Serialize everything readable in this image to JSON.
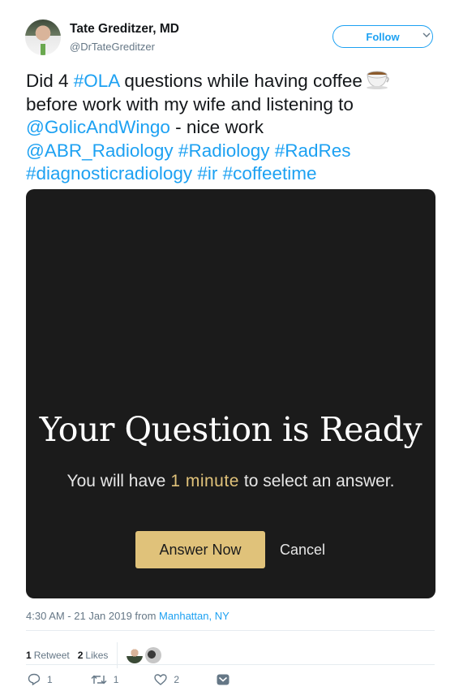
{
  "author": {
    "name": "Tate Greditzer, MD",
    "handle": "@DrTateGreditzer"
  },
  "follow_label": "Follow",
  "tweet": {
    "line1_a": "Did 4 ",
    "line1_tag": "#OLA",
    "line1_b": " questions while having coffee",
    "line2": "before work with my wife and listening to",
    "line3_mention": "@GolicAndWingo",
    "line3_b": " - nice work",
    "line4": "@ABR_Radiology #Radiology #RadRes",
    "line5": "#diagnosticradiology #ir #coffeetime"
  },
  "media": {
    "headline": "Your Question is Ready",
    "sub_a": "You will have",
    "sub_highlight": "1 minute",
    "sub_b": "to select an answer.",
    "answer_label": "Answer Now",
    "cancel_label": "Cancel"
  },
  "meta": {
    "time": "4:30 AM - 21 Jan 2019 from ",
    "location": "Manhattan, NY"
  },
  "stats": {
    "retweet_count": "1",
    "retweet_label": "Retweet",
    "likes_count": "2",
    "likes_label": "Likes"
  },
  "actions": {
    "reply_count": "1",
    "retweet_count": "1",
    "like_count": "2"
  },
  "colors": {
    "link": "#1da1f2",
    "gold": "#e0c27a",
    "media_bg": "#1b1b1b"
  }
}
